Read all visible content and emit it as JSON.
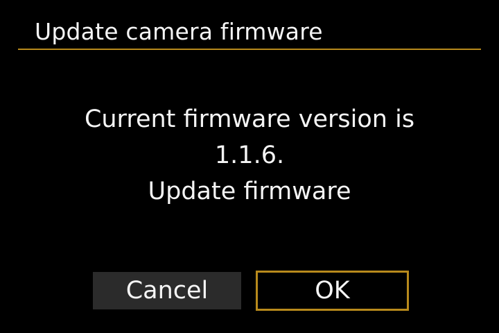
{
  "dialog": {
    "title": "Update camera firmware",
    "message_lines": [
      "Current firmware version is",
      "1.1.6.",
      "Update firmware"
    ]
  },
  "buttons": {
    "cancel_label": "Cancel",
    "ok_label": "OK"
  },
  "colors": {
    "background": "#000000",
    "text": "#f5f5f5",
    "accent": "#b88a1c",
    "button_inactive": "#2b2b2b"
  }
}
